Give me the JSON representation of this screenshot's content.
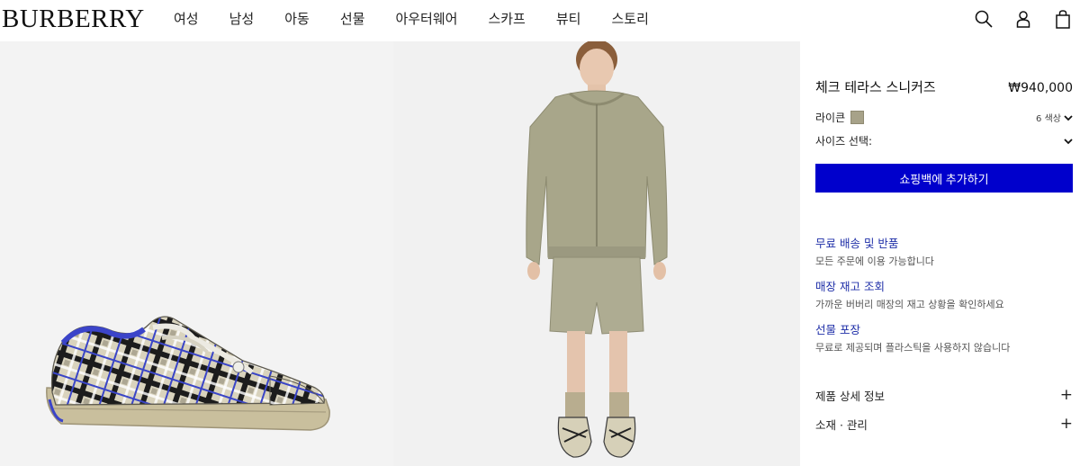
{
  "header": {
    "logo": "BURBERRY",
    "nav": [
      "여성",
      "남성",
      "아동",
      "선물",
      "아우터웨어",
      "스카프",
      "뷰티",
      "스토리"
    ],
    "icons": [
      "search-icon",
      "account-icon",
      "shopping-bag-icon"
    ]
  },
  "gallery": {
    "images": [
      "sneaker-product-image",
      "model-wearing-outfit-image"
    ]
  },
  "product": {
    "title": "체크 테라스 스니커즈",
    "price": "₩940,000",
    "color_name": "라이큰",
    "color_swatch": "#a7a289",
    "color_count": "6 색상",
    "size_label": "사이즈 선택:",
    "add_to_bag": "쇼핑백에 추가하기",
    "button_color": "#0000cc"
  },
  "services": [
    {
      "title": "무료 배송 및 반품",
      "desc": "모든 주문에 이용 가능합니다"
    },
    {
      "title": "매장 재고 조회",
      "desc": "가까운 버버리 매장의 재고 상황을 확인하세요"
    },
    {
      "title": "선물 포장",
      "desc": "무료로 제공되며 플라스틱을 사용하지 않습니다"
    }
  ],
  "accordions": [
    {
      "label": "제품 상세 정보",
      "icon": "+"
    },
    {
      "label": "소재 · 관리",
      "icon": "+"
    }
  ]
}
